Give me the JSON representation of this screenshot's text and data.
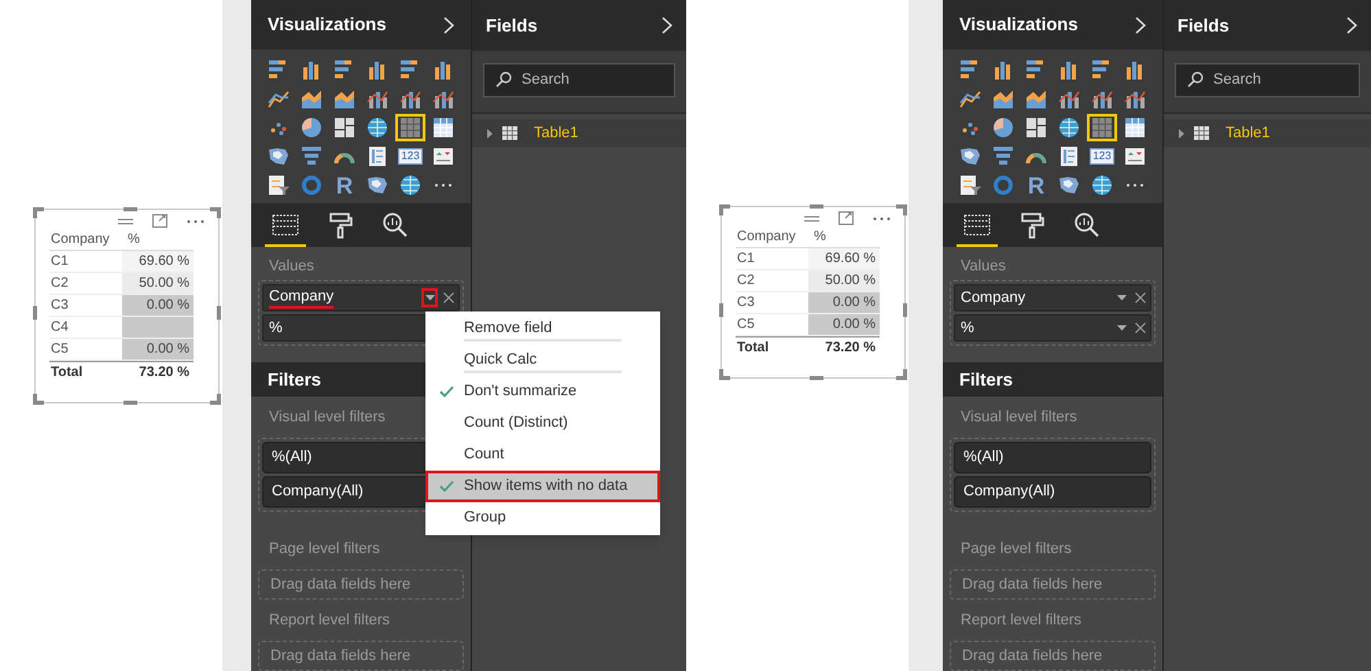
{
  "panes": [
    {
      "visual": {
        "columns": [
          "Company",
          "%"
        ],
        "rows": [
          {
            "company": "C1",
            "value": "69.60 %",
            "color": "#f4f4f4"
          },
          {
            "company": "C2",
            "value": "50.00 %",
            "color": "#ebebeb"
          },
          {
            "company": "C3",
            "value": "0.00 %",
            "color": "#c8c8c8"
          },
          {
            "company": "C4",
            "color": "#c8c8c8"
          },
          {
            "company": "C5",
            "value": "0.00 %",
            "color": "#c8c8c8"
          }
        ],
        "total": {
          "label": "Total",
          "value": "73.20 %"
        }
      },
      "visualizations": {
        "title": "Visualizations",
        "visual_types": [
          {
            "kind": "hbar",
            "selected": false
          },
          {
            "kind": "column",
            "selected": false
          },
          {
            "kind": "hbar",
            "selected": false
          },
          {
            "kind": "column",
            "selected": false
          },
          {
            "kind": "hbar",
            "selected": false
          },
          {
            "kind": "column",
            "selected": false
          },
          {
            "kind": "line",
            "selected": false
          },
          {
            "kind": "area",
            "selected": false
          },
          {
            "kind": "area",
            "selected": false
          },
          {
            "kind": "combo",
            "selected": false
          },
          {
            "kind": "combo",
            "selected": false
          },
          {
            "kind": "combo",
            "selected": false
          },
          {
            "kind": "scatter",
            "selected": false
          },
          {
            "kind": "pie",
            "selected": false
          },
          {
            "kind": "treemap",
            "selected": false
          },
          {
            "kind": "globe",
            "selected": false
          },
          {
            "kind": "table",
            "selected": true
          },
          {
            "kind": "matrix",
            "selected": false
          },
          {
            "kind": "map",
            "selected": false
          },
          {
            "kind": "funnel",
            "selected": false
          },
          {
            "kind": "gauge",
            "selected": false
          },
          {
            "kind": "multirow",
            "selected": false
          },
          {
            "kind": "card",
            "label": "123",
            "selected": false
          },
          {
            "kind": "kpi",
            "selected": false
          },
          {
            "kind": "slicer",
            "selected": false
          },
          {
            "kind": "donut",
            "selected": false
          },
          {
            "kind": "letter",
            "label": "R",
            "selected": false
          },
          {
            "kind": "map",
            "selected": false
          },
          {
            "kind": "globe",
            "selected": false
          },
          {
            "kind": "more",
            "selected": false
          }
        ],
        "tabs": [
          {
            "kind": "fields",
            "selected": true
          },
          {
            "kind": "format",
            "selected": false
          },
          {
            "kind": "analytics",
            "selected": false
          }
        ],
        "values_label": "Values",
        "value_fields": [
          {
            "label": "Company",
            "menu_open": true
          },
          {
            "label": "%",
            "menu_open": false
          }
        ]
      },
      "filters": {
        "title": "Filters",
        "visual_label": "Visual level filters",
        "visual_filters": [
          "%(All)",
          "Company(All)"
        ],
        "page_label": "Page level filters",
        "page_drop": "Drag data fields here",
        "report_label": "Report level filters",
        "report_drop": "Drag data fields here"
      },
      "fields": {
        "title": "Fields",
        "search": {
          "placeholder": "Search"
        },
        "tables": [
          {
            "name": "Table1",
            "expanded": false
          }
        ]
      },
      "context_menu": {
        "items": [
          {
            "label": "Remove field",
            "checked": false,
            "selected": false,
            "divider_after": true
          },
          {
            "label": "Quick Calc",
            "checked": false,
            "selected": false,
            "divider_after": true
          },
          {
            "label": "Don't summarize",
            "checked": true,
            "selected": false,
            "divider_after": false
          },
          {
            "label": "Count (Distinct)",
            "checked": false,
            "selected": false,
            "divider_after": false
          },
          {
            "label": "Count",
            "checked": false,
            "selected": false,
            "divider_after": false
          },
          {
            "label": "Show items with no data",
            "checked": true,
            "selected": true,
            "divider_after": false
          },
          {
            "label": "Group",
            "checked": false,
            "selected": false,
            "divider_after": false
          }
        ]
      }
    },
    {
      "visual": {
        "columns": [
          "Company",
          "%"
        ],
        "rows": [
          {
            "company": "C1",
            "value": "69.60 %",
            "color": "#f4f4f4"
          },
          {
            "company": "C2",
            "value": "50.00 %",
            "color": "#ebebeb"
          },
          {
            "company": "C3",
            "value": "0.00 %",
            "color": "#c8c8c8"
          },
          {
            "company": "C5",
            "value": "0.00 %",
            "color": "#c8c8c8"
          }
        ],
        "total": {
          "label": "Total",
          "value": "73.20 %"
        }
      },
      "visualizations": {
        "title": "Visualizations",
        "visual_types": [
          {
            "kind": "hbar",
            "selected": false
          },
          {
            "kind": "column",
            "selected": false
          },
          {
            "kind": "hbar",
            "selected": false
          },
          {
            "kind": "column",
            "selected": false
          },
          {
            "kind": "hbar",
            "selected": false
          },
          {
            "kind": "column",
            "selected": false
          },
          {
            "kind": "line",
            "selected": false
          },
          {
            "kind": "area",
            "selected": false
          },
          {
            "kind": "area",
            "selected": false
          },
          {
            "kind": "combo",
            "selected": false
          },
          {
            "kind": "combo",
            "selected": false
          },
          {
            "kind": "combo",
            "selected": false
          },
          {
            "kind": "scatter",
            "selected": false
          },
          {
            "kind": "pie",
            "selected": false
          },
          {
            "kind": "treemap",
            "selected": false
          },
          {
            "kind": "globe",
            "selected": false
          },
          {
            "kind": "table",
            "selected": true
          },
          {
            "kind": "matrix",
            "selected": false
          },
          {
            "kind": "map",
            "selected": false
          },
          {
            "kind": "funnel",
            "selected": false
          },
          {
            "kind": "gauge",
            "selected": false
          },
          {
            "kind": "multirow",
            "selected": false
          },
          {
            "kind": "card",
            "label": "123",
            "selected": false
          },
          {
            "kind": "kpi",
            "selected": false
          },
          {
            "kind": "slicer",
            "selected": false
          },
          {
            "kind": "donut",
            "selected": false
          },
          {
            "kind": "letter",
            "label": "R",
            "selected": false
          },
          {
            "kind": "map",
            "selected": false
          },
          {
            "kind": "globe",
            "selected": false
          },
          {
            "kind": "more",
            "selected": false
          }
        ],
        "tabs": [
          {
            "kind": "fields",
            "selected": true
          },
          {
            "kind": "format",
            "selected": false
          },
          {
            "kind": "analytics",
            "selected": false
          }
        ],
        "values_label": "Values",
        "value_fields": [
          {
            "label": "Company",
            "menu_open": false
          },
          {
            "label": "%",
            "menu_open": false
          }
        ]
      },
      "filters": {
        "title": "Filters",
        "visual_label": "Visual level filters",
        "visual_filters": [
          "%(All)",
          "Company(All)"
        ],
        "page_label": "Page level filters",
        "page_drop": "Drag data fields here",
        "report_label": "Report level filters",
        "report_drop": "Drag data fields here"
      },
      "fields": {
        "title": "Fields",
        "search": {
          "placeholder": "Search"
        },
        "tables": [
          {
            "name": "Table1",
            "expanded": false
          }
        ]
      }
    }
  ]
}
